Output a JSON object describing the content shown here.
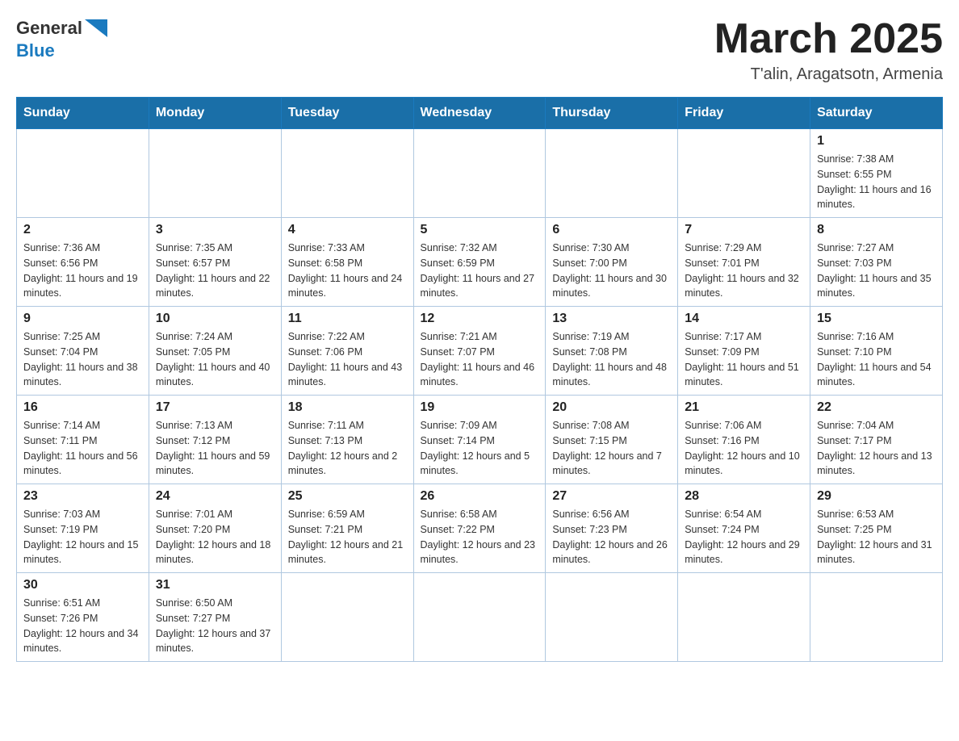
{
  "header": {
    "logo_line1": "General",
    "logo_line2": "Blue",
    "month_title": "March 2025",
    "subtitle": "T'alin, Aragatsotn, Armenia"
  },
  "days_of_week": [
    "Sunday",
    "Monday",
    "Tuesday",
    "Wednesday",
    "Thursday",
    "Friday",
    "Saturday"
  ],
  "weeks": [
    [
      {
        "day": "",
        "sunrise": "",
        "sunset": "",
        "daylight": ""
      },
      {
        "day": "",
        "sunrise": "",
        "sunset": "",
        "daylight": ""
      },
      {
        "day": "",
        "sunrise": "",
        "sunset": "",
        "daylight": ""
      },
      {
        "day": "",
        "sunrise": "",
        "sunset": "",
        "daylight": ""
      },
      {
        "day": "",
        "sunrise": "",
        "sunset": "",
        "daylight": ""
      },
      {
        "day": "",
        "sunrise": "",
        "sunset": "",
        "daylight": ""
      },
      {
        "day": "1",
        "sunrise": "Sunrise: 7:38 AM",
        "sunset": "Sunset: 6:55 PM",
        "daylight": "Daylight: 11 hours and 16 minutes."
      }
    ],
    [
      {
        "day": "2",
        "sunrise": "Sunrise: 7:36 AM",
        "sunset": "Sunset: 6:56 PM",
        "daylight": "Daylight: 11 hours and 19 minutes."
      },
      {
        "day": "3",
        "sunrise": "Sunrise: 7:35 AM",
        "sunset": "Sunset: 6:57 PM",
        "daylight": "Daylight: 11 hours and 22 minutes."
      },
      {
        "day": "4",
        "sunrise": "Sunrise: 7:33 AM",
        "sunset": "Sunset: 6:58 PM",
        "daylight": "Daylight: 11 hours and 24 minutes."
      },
      {
        "day": "5",
        "sunrise": "Sunrise: 7:32 AM",
        "sunset": "Sunset: 6:59 PM",
        "daylight": "Daylight: 11 hours and 27 minutes."
      },
      {
        "day": "6",
        "sunrise": "Sunrise: 7:30 AM",
        "sunset": "Sunset: 7:00 PM",
        "daylight": "Daylight: 11 hours and 30 minutes."
      },
      {
        "day": "7",
        "sunrise": "Sunrise: 7:29 AM",
        "sunset": "Sunset: 7:01 PM",
        "daylight": "Daylight: 11 hours and 32 minutes."
      },
      {
        "day": "8",
        "sunrise": "Sunrise: 7:27 AM",
        "sunset": "Sunset: 7:03 PM",
        "daylight": "Daylight: 11 hours and 35 minutes."
      }
    ],
    [
      {
        "day": "9",
        "sunrise": "Sunrise: 7:25 AM",
        "sunset": "Sunset: 7:04 PM",
        "daylight": "Daylight: 11 hours and 38 minutes."
      },
      {
        "day": "10",
        "sunrise": "Sunrise: 7:24 AM",
        "sunset": "Sunset: 7:05 PM",
        "daylight": "Daylight: 11 hours and 40 minutes."
      },
      {
        "day": "11",
        "sunrise": "Sunrise: 7:22 AM",
        "sunset": "Sunset: 7:06 PM",
        "daylight": "Daylight: 11 hours and 43 minutes."
      },
      {
        "day": "12",
        "sunrise": "Sunrise: 7:21 AM",
        "sunset": "Sunset: 7:07 PM",
        "daylight": "Daylight: 11 hours and 46 minutes."
      },
      {
        "day": "13",
        "sunrise": "Sunrise: 7:19 AM",
        "sunset": "Sunset: 7:08 PM",
        "daylight": "Daylight: 11 hours and 48 minutes."
      },
      {
        "day": "14",
        "sunrise": "Sunrise: 7:17 AM",
        "sunset": "Sunset: 7:09 PM",
        "daylight": "Daylight: 11 hours and 51 minutes."
      },
      {
        "day": "15",
        "sunrise": "Sunrise: 7:16 AM",
        "sunset": "Sunset: 7:10 PM",
        "daylight": "Daylight: 11 hours and 54 minutes."
      }
    ],
    [
      {
        "day": "16",
        "sunrise": "Sunrise: 7:14 AM",
        "sunset": "Sunset: 7:11 PM",
        "daylight": "Daylight: 11 hours and 56 minutes."
      },
      {
        "day": "17",
        "sunrise": "Sunrise: 7:13 AM",
        "sunset": "Sunset: 7:12 PM",
        "daylight": "Daylight: 11 hours and 59 minutes."
      },
      {
        "day": "18",
        "sunrise": "Sunrise: 7:11 AM",
        "sunset": "Sunset: 7:13 PM",
        "daylight": "Daylight: 12 hours and 2 minutes."
      },
      {
        "day": "19",
        "sunrise": "Sunrise: 7:09 AM",
        "sunset": "Sunset: 7:14 PM",
        "daylight": "Daylight: 12 hours and 5 minutes."
      },
      {
        "day": "20",
        "sunrise": "Sunrise: 7:08 AM",
        "sunset": "Sunset: 7:15 PM",
        "daylight": "Daylight: 12 hours and 7 minutes."
      },
      {
        "day": "21",
        "sunrise": "Sunrise: 7:06 AM",
        "sunset": "Sunset: 7:16 PM",
        "daylight": "Daylight: 12 hours and 10 minutes."
      },
      {
        "day": "22",
        "sunrise": "Sunrise: 7:04 AM",
        "sunset": "Sunset: 7:17 PM",
        "daylight": "Daylight: 12 hours and 13 minutes."
      }
    ],
    [
      {
        "day": "23",
        "sunrise": "Sunrise: 7:03 AM",
        "sunset": "Sunset: 7:19 PM",
        "daylight": "Daylight: 12 hours and 15 minutes."
      },
      {
        "day": "24",
        "sunrise": "Sunrise: 7:01 AM",
        "sunset": "Sunset: 7:20 PM",
        "daylight": "Daylight: 12 hours and 18 minutes."
      },
      {
        "day": "25",
        "sunrise": "Sunrise: 6:59 AM",
        "sunset": "Sunset: 7:21 PM",
        "daylight": "Daylight: 12 hours and 21 minutes."
      },
      {
        "day": "26",
        "sunrise": "Sunrise: 6:58 AM",
        "sunset": "Sunset: 7:22 PM",
        "daylight": "Daylight: 12 hours and 23 minutes."
      },
      {
        "day": "27",
        "sunrise": "Sunrise: 6:56 AM",
        "sunset": "Sunset: 7:23 PM",
        "daylight": "Daylight: 12 hours and 26 minutes."
      },
      {
        "day": "28",
        "sunrise": "Sunrise: 6:54 AM",
        "sunset": "Sunset: 7:24 PM",
        "daylight": "Daylight: 12 hours and 29 minutes."
      },
      {
        "day": "29",
        "sunrise": "Sunrise: 6:53 AM",
        "sunset": "Sunset: 7:25 PM",
        "daylight": "Daylight: 12 hours and 31 minutes."
      }
    ],
    [
      {
        "day": "30",
        "sunrise": "Sunrise: 6:51 AM",
        "sunset": "Sunset: 7:26 PM",
        "daylight": "Daylight: 12 hours and 34 minutes."
      },
      {
        "day": "31",
        "sunrise": "Sunrise: 6:50 AM",
        "sunset": "Sunset: 7:27 PM",
        "daylight": "Daylight: 12 hours and 37 minutes."
      },
      {
        "day": "",
        "sunrise": "",
        "sunset": "",
        "daylight": ""
      },
      {
        "day": "",
        "sunrise": "",
        "sunset": "",
        "daylight": ""
      },
      {
        "day": "",
        "sunrise": "",
        "sunset": "",
        "daylight": ""
      },
      {
        "day": "",
        "sunrise": "",
        "sunset": "",
        "daylight": ""
      },
      {
        "day": "",
        "sunrise": "",
        "sunset": "",
        "daylight": ""
      }
    ]
  ]
}
